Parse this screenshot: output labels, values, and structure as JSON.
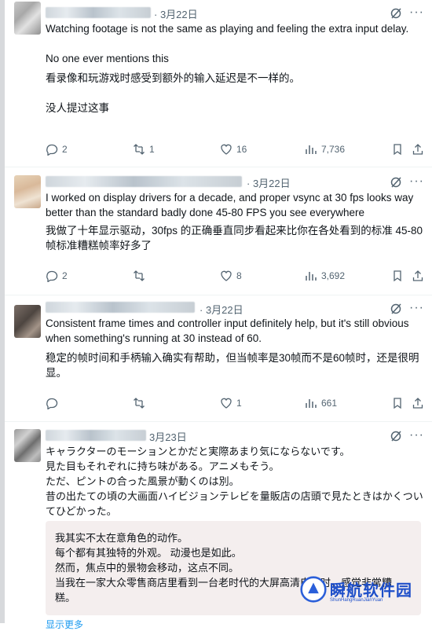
{
  "tweets": [
    {
      "date": "· 3月22日",
      "lines": [
        "Watching footage is not the same as playing and feeling the extra input delay.",
        "",
        "No one ever mentions this",
        "看录像和玩游戏时感受到额外的输入延迟是不一样的。",
        "",
        "没人提过这事"
      ],
      "stats": {
        "replies": "2",
        "reposts": "1",
        "likes": "16",
        "views": "7,736"
      }
    },
    {
      "date": "· 3月22日",
      "lines": [
        "I worked on display drivers for a decade, and proper vsync at 30 fps looks way better than the standard badly done 45-80 FPS you see everywhere",
        "我做了十年显示驱动，30fps 的正确垂直同步看起来比你在各处看到的标准 45-80 帧标准糟糕帧率好多了"
      ],
      "stats": {
        "replies": "2",
        "reposts": "",
        "likes": "8",
        "views": "3,692"
      }
    },
    {
      "date": "· 3月22日",
      "lines": [
        "Consistent frame times and controller input definitely help, but it's still obvious when something's running at 30 instead of 60.",
        "稳定的帧时间和手柄输入确实有帮助，但当帧率是30帧而不是60帧时，还是很明显。"
      ],
      "stats": {
        "replies": "",
        "reposts": "",
        "likes": "1",
        "views": "661"
      }
    },
    {
      "date": "3月23日",
      "lines": [
        "キャラクターのモーションとかだと実際あまり気にならないです。",
        "見た目もそれぞれに持ち味がある。アニメもそう。",
        "ただ、ピントの合った風景が動くのは別。",
        "昔の出たての頃の大画面ハイビジョンテレビを量販店の店頭で見たときはかくついてひどかった。"
      ],
      "translation": [
        "我其实不太在意角色的动作。",
        "每个都有其独特的外观。 动漫也是如此。",
        "然而，焦点中的景物会移动，这点不同。",
        "当我在一家大众零售商店里看到一台老时代的大屏高清电视时，感觉非常糟糕。"
      ],
      "show_more": "显示更多"
    }
  ],
  "watermark": {
    "brand": "瞬航软件园",
    "sub": "ShunHangRuanJianYuan"
  },
  "colors": {
    "text": "#0f1419",
    "muted": "#536471",
    "link": "#1d9bf0",
    "translation_bg": "#f4eeee"
  }
}
